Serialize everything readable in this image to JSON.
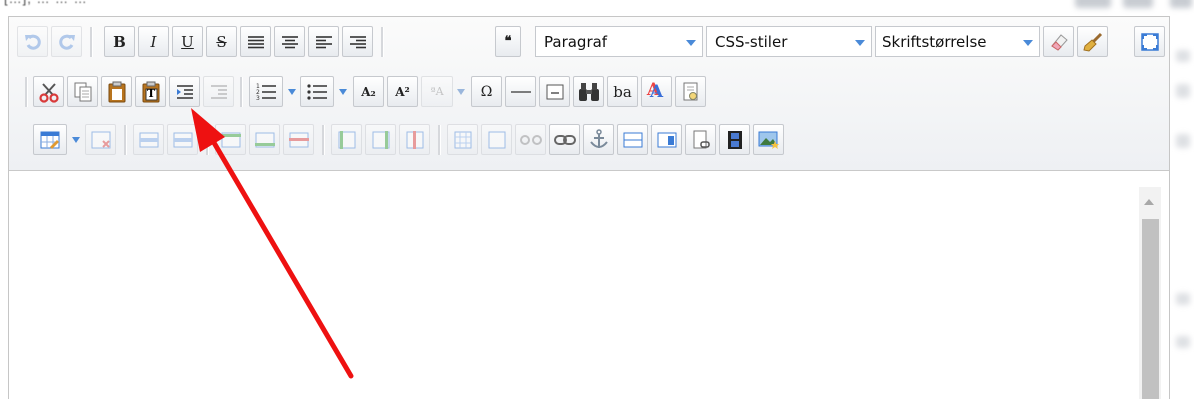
{
  "clipped_top_text": "[…], … … …",
  "format_dropdown": {
    "value": "Paragraf"
  },
  "css_dropdown": {
    "value": "CSS-stiler"
  },
  "size_dropdown": {
    "value": "Skriftstørrelse"
  },
  "row1_buttons": {
    "bold": "B",
    "italic": "I",
    "underline": "U",
    "strike": "S",
    "blockquote": "❝"
  },
  "row2_buttons": {
    "paste_text": "T",
    "subscript": "A₂",
    "superscript": "A²",
    "special_char": "Ω",
    "spellcheck": "ba",
    "font_color": "A"
  },
  "colors": {
    "accent_blue": "#3a7bd5",
    "arrow_red": "#ee1111",
    "toolbar_bg": "#f3f4f6",
    "border": "#c6c9ce"
  }
}
